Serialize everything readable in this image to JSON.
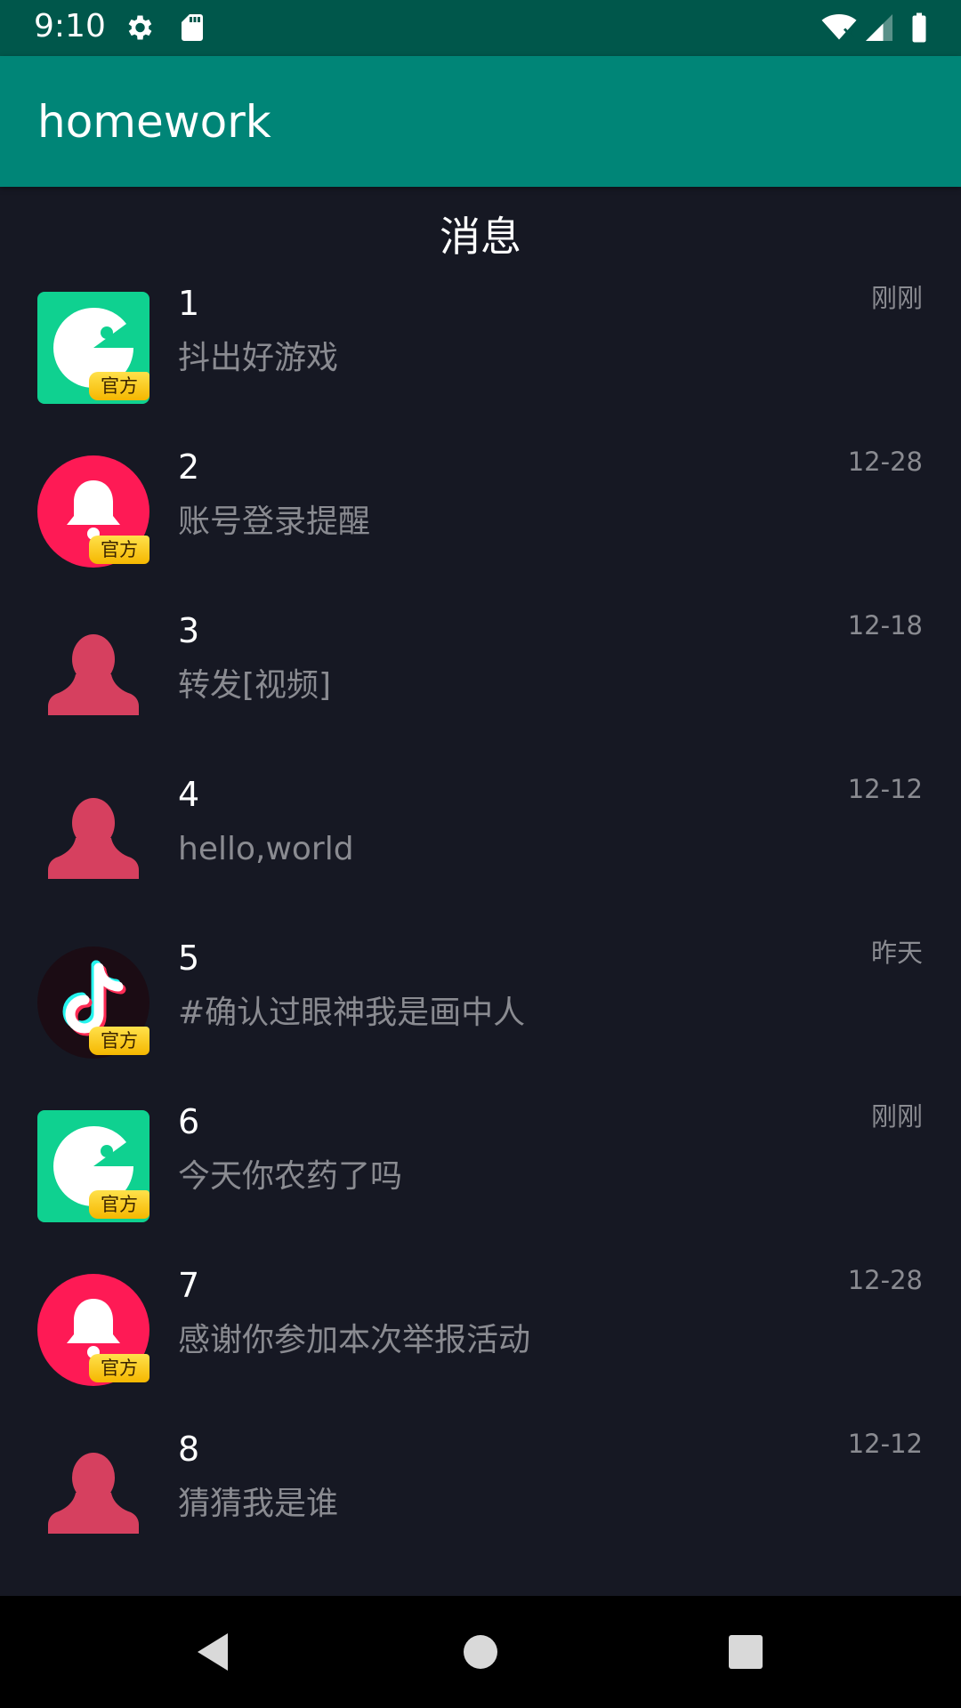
{
  "status_bar": {
    "time": "9:10",
    "icons": [
      "gear-icon",
      "sd-card-icon",
      "wifi-icon",
      "signal-icon",
      "battery-icon"
    ]
  },
  "app_bar": {
    "title": "homework"
  },
  "page": {
    "title": "消息"
  },
  "messages": [
    {
      "name": "1",
      "text": "抖出好游戏",
      "time": "刚刚",
      "avatar": "game-icon",
      "official": true
    },
    {
      "name": "2",
      "text": "账号登录提醒",
      "time": "12-28",
      "avatar": "bell-icon",
      "official": true
    },
    {
      "name": "3",
      "text": "转发[视频]",
      "time": "12-18",
      "avatar": "user-silhouette-icon",
      "official": false
    },
    {
      "name": "4",
      "text": "hello,world",
      "time": "12-12",
      "avatar": "user-silhouette-icon",
      "official": false
    },
    {
      "name": "5",
      "text": "#确认过眼神我是画中人",
      "time": "昨天",
      "avatar": "tiktok-icon",
      "official": true
    },
    {
      "name": "6",
      "text": "今天你农药了吗",
      "time": "刚刚",
      "avatar": "game-icon",
      "official": true
    },
    {
      "name": "7",
      "text": "感谢你参加本次举报活动",
      "time": "12-28",
      "avatar": "bell-icon",
      "official": true
    },
    {
      "name": "8",
      "text": "猜猜我是谁",
      "time": "12-12",
      "avatar": "user-silhouette-icon",
      "official": false
    }
  ],
  "badge_label": "官方",
  "colors": {
    "status_bar": "#00574b",
    "app_bar": "#008577",
    "background": "#161823",
    "badge": "#f5c400",
    "game_green": "#0fd190",
    "bell_red": "#fe1a55",
    "silhouette": "#d6405f"
  },
  "nav_bar": {
    "icons": [
      "back-icon",
      "home-icon",
      "recents-icon"
    ]
  }
}
